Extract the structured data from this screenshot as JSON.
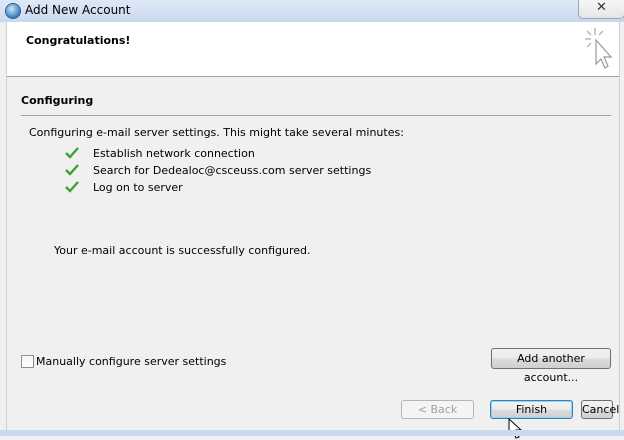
{
  "window": {
    "title": "Add New Account",
    "close_glyph": "✕",
    "icon": "outlook-globe-icon"
  },
  "header": {
    "title": "Congratulations!",
    "icon": "sparkle-cursor-icon"
  },
  "section": {
    "title": "Configuring"
  },
  "progress": {
    "intro": "Configuring e-mail server settings. This might take several minutes:",
    "steps": [
      {
        "label": "Establish network connection",
        "status": "done"
      },
      {
        "label": "Search for Dedealoc@csceuss.com server settings",
        "status": "done"
      },
      {
        "label": "Log on to server",
        "status": "done"
      }
    ],
    "result": "Your e-mail account is successfully configured."
  },
  "manual_config": {
    "label": "Manually configure server settings",
    "checked": false
  },
  "buttons": {
    "add_another": "Add another account...",
    "back": "< Back",
    "finish": "Finish",
    "cancel": "Cancel"
  },
  "colors": {
    "check_green": "#3aa335",
    "header_bg": "#ffffff",
    "dialog_bg": "#f0f0f0"
  }
}
